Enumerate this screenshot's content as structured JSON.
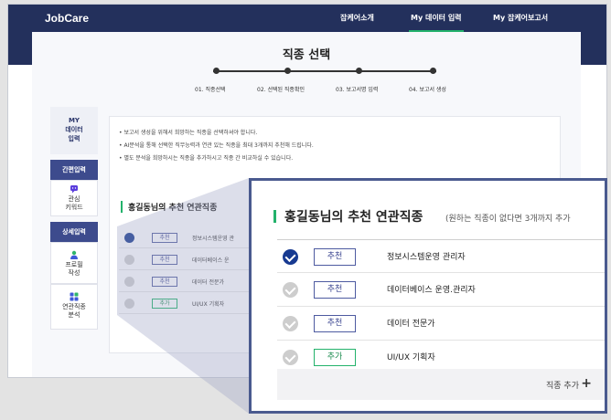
{
  "header": {
    "logo": "JobCare",
    "nav": [
      {
        "label": "잡케어소개",
        "active": false
      },
      {
        "label": "My 데이터 입력",
        "active": true
      },
      {
        "label": "My 잡케어보고서",
        "active": false
      }
    ]
  },
  "page": {
    "title": "직종 선택",
    "steps": [
      "01. 직종선택",
      "02. 선택된 직종확인",
      "03. 보고서명 입력",
      "04. 보고서 생성"
    ]
  },
  "sidebar": {
    "top_label_1": "MY",
    "top_label_2": "데이터",
    "top_label_3": "입력",
    "section_1": "간편입력",
    "item_1_a": "관심",
    "item_1_b": "키워드",
    "section_2": "상세입력",
    "item_2_a": "프로필",
    "item_2_b": "작성",
    "item_3_a": "연관직종",
    "item_3_b": "분석"
  },
  "instructions": [
    "• 보고서 생성을 위해서 희망하는 직종을 선택하셔야 합니다.",
    "• AI분석을 통해 선택한 직무능력과 연관 있는 직종을 최대 3개까지 추천해 드립니다.",
    "• 별도 분석을 희망하시는 직종을 추가하시고 직종 간 비교하실 수 있습니다."
  ],
  "related": {
    "title": "홍길동님의 추천 연관직종",
    "subtitle": "(원하는 직종이 없다면 3개까지 추가",
    "bg_items": [
      {
        "tag": "추천",
        "name": "정보시스템운영 관"
      },
      {
        "tag": "추천",
        "name": "데이터베이스 운"
      },
      {
        "tag": "추천",
        "name": "데이터 전문가"
      },
      {
        "tag": "추가",
        "name": "UI/UX 기획자"
      }
    ],
    "rows": [
      {
        "tag": "추천",
        "name": "정보시스템운영 관리자",
        "checked": true,
        "type": "recommend"
      },
      {
        "tag": "추천",
        "name": "데이터베이스 운영.관리자",
        "checked": false,
        "type": "recommend"
      },
      {
        "tag": "추천",
        "name": "데이터 전문가",
        "checked": false,
        "type": "recommend"
      },
      {
        "tag": "추가",
        "name": "UI/UX 기획자",
        "checked": false,
        "type": "add"
      }
    ],
    "add_label": "직종 추가",
    "add_icon": "plus-icon"
  },
  "colors": {
    "navy": "#23305c",
    "accent_green": "#23b26b",
    "check_blue": "#173a91",
    "frame_blue": "#4a5a8f"
  }
}
